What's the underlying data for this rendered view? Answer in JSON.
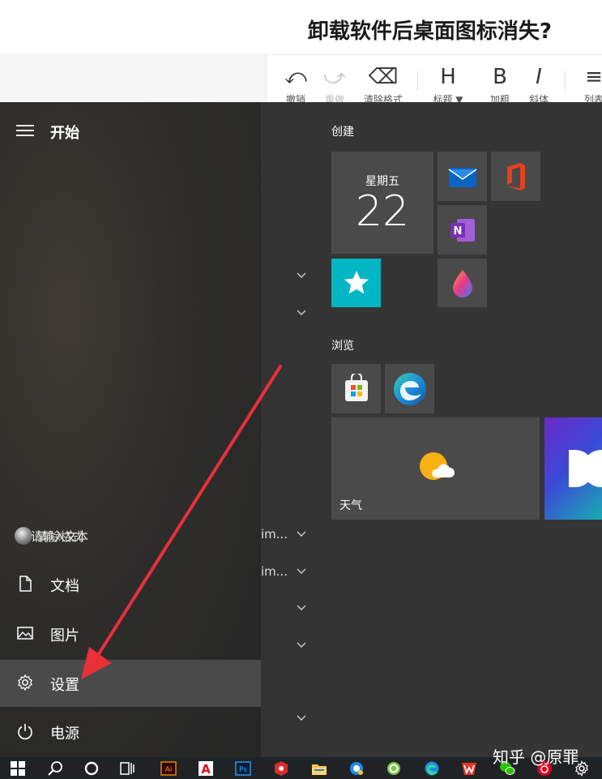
{
  "editor": {
    "title": "卸载软件后桌面图标消失?",
    "toolbar": [
      {
        "icon": "undo-icon",
        "glyph": "⤺",
        "label": "撤销",
        "enabled": true
      },
      {
        "icon": "redo-icon",
        "glyph": "⤻",
        "label": "重做",
        "enabled": false
      },
      {
        "icon": "eraser-icon",
        "glyph": "⌫",
        "label": "清除格式",
        "enabled": true
      },
      {
        "icon": "heading-icon",
        "glyph": "H",
        "label": "标题 ▼",
        "enabled": true
      },
      {
        "icon": "bold-icon",
        "glyph": "B",
        "label": "加粗",
        "enabled": true
      },
      {
        "icon": "italic-icon",
        "glyph": "I",
        "label": "斜体",
        "enabled": true
      },
      {
        "icon": "list-icon",
        "glyph": "≡",
        "label": "列表",
        "enabled": true
      }
    ]
  },
  "start_menu": {
    "title": "开始",
    "user": {
      "name": "请输入文本",
      "overlay": "清除格式"
    },
    "side_items": [
      {
        "icon": "document-icon",
        "label": "文档"
      },
      {
        "icon": "pictures-icon",
        "label": "图片"
      },
      {
        "icon": "settings-gear-icon",
        "label": "设置"
      },
      {
        "icon": "power-icon",
        "label": "电源"
      }
    ],
    "middle_texts": [
      "im...",
      "im..."
    ],
    "groups": {
      "create": "创建",
      "browse": "浏览"
    },
    "calendar": {
      "day": "星期五",
      "date": "22"
    },
    "weather_label": "天气"
  },
  "taskbar": {
    "items": [
      "windows-start-icon",
      "search-icon",
      "cortana-icon",
      "task-view-icon",
      "illustrator-icon",
      "acrobat-icon",
      "photoshop-icon",
      "app-red-icon",
      "file-explorer-icon",
      "qq-browser-icon",
      "app-green-icon",
      "edge-icon",
      "wps-icon",
      "wechat-icon",
      "netease-music-icon",
      "settings-icon"
    ]
  },
  "watermark": "知乎 @原罪",
  "colors": {
    "accent_teal": "#00b7c3",
    "arrow_red": "#e8303a",
    "tile_gray": "#4a4a4a"
  }
}
